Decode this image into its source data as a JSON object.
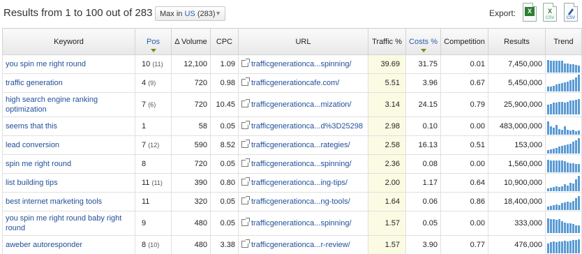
{
  "header": {
    "title": "Results from 1 to 100 out of 283",
    "database_select": {
      "prefix": "Max in",
      "db": "US",
      "count": "(283)"
    },
    "export_label": "Export:",
    "export_icons": [
      {
        "name": "excel-export-icon",
        "glyph": "X",
        "caption": ""
      },
      {
        "name": "csv-export-icon",
        "glyph": "X",
        "caption": "CSV"
      },
      {
        "name": "csv-semicolon-export-icon",
        "glyph": "",
        "caption": "CSV"
      }
    ]
  },
  "columns": [
    "Keyword",
    "Pos",
    "Δ Volume",
    "CPC",
    "URL",
    "Traffic %",
    "Costs %",
    "Competition",
    "Results",
    "Trend"
  ],
  "sorted_columns": [
    "Pos",
    "Costs %"
  ],
  "colors": {
    "link": "#1f4f99",
    "sorted_header": "#2a5db0",
    "traffic_bg": "#fbfbe4",
    "trend_bar": "#5a9bd5"
  },
  "rows": [
    {
      "keyword": "you spin me right round",
      "pos": "10",
      "prev": "(11)",
      "volume": "12,100",
      "cpc": "1.09",
      "url": "trafficgenerationca...spinning/",
      "traffic": "39.69",
      "costs": "31.75",
      "competition": "0.01",
      "results": "7,450,000",
      "trend": [
        0.75,
        0.7,
        0.7,
        0.72,
        0.72,
        0.7,
        0.55,
        0.55,
        0.5,
        0.5,
        0.45,
        0.4
      ]
    },
    {
      "keyword": "traffic generation",
      "pos": "4",
      "prev": "(9)",
      "volume": "720",
      "cpc": "0.98",
      "url": "trafficgenerationcafe.com/",
      "traffic": "5.51",
      "costs": "3.96",
      "competition": "0.67",
      "results": "5,450,000",
      "trend": [
        0.3,
        0.3,
        0.35,
        0.4,
        0.45,
        0.5,
        0.55,
        0.6,
        0.65,
        0.7,
        0.85,
        1.0
      ]
    },
    {
      "keyword": "high search engine ranking optimization",
      "pos": "7",
      "prev": "(6)",
      "volume": "720",
      "cpc": "10.45",
      "url": "trafficgenerationca...mization/",
      "traffic": "3.14",
      "costs": "24.15",
      "competition": "0.79",
      "results": "25,900,000",
      "trend": [
        0.5,
        0.55,
        0.6,
        0.6,
        0.65,
        0.65,
        0.6,
        0.65,
        0.7,
        0.7,
        0.75,
        0.8
      ]
    },
    {
      "keyword": "seems that this",
      "pos": "1",
      "prev": "",
      "volume": "58",
      "cpc": "0.05",
      "url": "trafficgenerationca...d%3D25298",
      "traffic": "2.98",
      "costs": "0.10",
      "competition": "0.00",
      "results": "483,000,000",
      "trend": [
        0.8,
        0.5,
        0.4,
        0.6,
        0.35,
        0.3,
        0.5,
        0.3,
        0.25,
        0.3,
        0.2,
        0.25
      ]
    },
    {
      "keyword": "lead conversion",
      "pos": "7",
      "prev": "(12)",
      "volume": "590",
      "cpc": "8.52",
      "url": "trafficgenerationca...rategies/",
      "traffic": "2.58",
      "costs": "16.13",
      "competition": "0.51",
      "results": "153,000",
      "trend": [
        0.2,
        0.25,
        0.3,
        0.35,
        0.4,
        0.45,
        0.5,
        0.55,
        0.6,
        0.7,
        0.8,
        0.9
      ]
    },
    {
      "keyword": "spin me right round",
      "pos": "8",
      "prev": "",
      "volume": "720",
      "cpc": "0.05",
      "url": "trafficgenerationca...spinning/",
      "traffic": "2.36",
      "costs": "0.08",
      "competition": "0.00",
      "results": "1,560,000",
      "trend": [
        0.75,
        0.72,
        0.72,
        0.7,
        0.7,
        0.7,
        0.68,
        0.6,
        0.55,
        0.55,
        0.5,
        0.5
      ]
    },
    {
      "keyword": "list building tips",
      "pos": "11",
      "prev": "(11)",
      "volume": "390",
      "cpc": "0.80",
      "url": "trafficgenerationca...ing-tips/",
      "traffic": "2.00",
      "costs": "1.17",
      "competition": "0.64",
      "results": "10,900,000",
      "trend": [
        0.15,
        0.2,
        0.25,
        0.3,
        0.25,
        0.3,
        0.4,
        0.35,
        0.5,
        0.45,
        0.7,
        0.9
      ]
    },
    {
      "keyword": "best internet marketing tools",
      "pos": "11",
      "prev": "",
      "volume": "320",
      "cpc": "0.05",
      "url": "trafficgenerationca...ng-tools/",
      "traffic": "1.64",
      "costs": "0.06",
      "competition": "0.86",
      "results": "18,400,000",
      "trend": [
        0.2,
        0.25,
        0.3,
        0.35,
        0.3,
        0.4,
        0.45,
        0.5,
        0.45,
        0.55,
        0.7,
        0.85
      ]
    },
    {
      "keyword": "you spin me right round baby right round",
      "pos": "9",
      "prev": "",
      "volume": "480",
      "cpc": "0.05",
      "url": "trafficgenerationca...spinning/",
      "traffic": "1.57",
      "costs": "0.05",
      "competition": "0.00",
      "results": "333,000",
      "trend": [
        0.75,
        0.7,
        0.72,
        0.68,
        0.7,
        0.6,
        0.55,
        0.5,
        0.5,
        0.45,
        0.4,
        0.4
      ]
    },
    {
      "keyword": "aweber autoresponder",
      "pos": "8",
      "prev": "(10)",
      "volume": "480",
      "cpc": "3.38",
      "url": "trafficgenerationca...r-review/",
      "traffic": "1.57",
      "costs": "3.90",
      "competition": "0.77",
      "results": "476,000",
      "trend": [
        0.6,
        0.65,
        0.7,
        0.65,
        0.7,
        0.7,
        0.75,
        0.7,
        0.75,
        0.8,
        0.8,
        0.85
      ]
    }
  ]
}
